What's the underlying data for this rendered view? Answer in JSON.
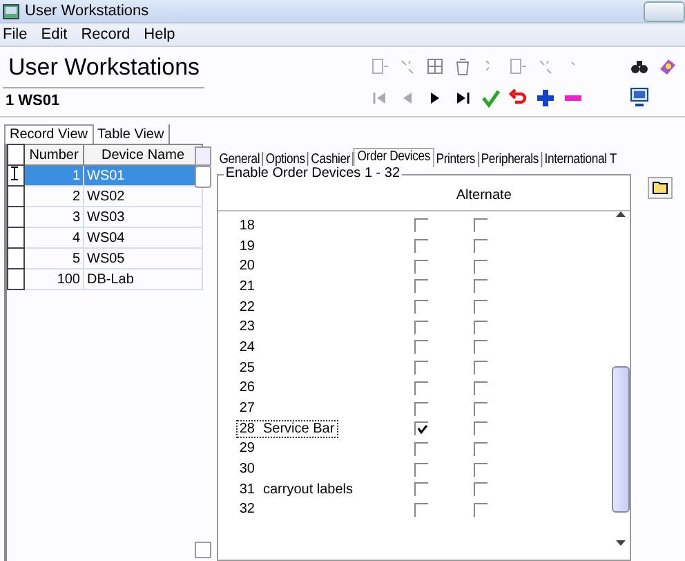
{
  "window": {
    "title": "User Workstations"
  },
  "menu": [
    "File",
    "Edit",
    "Record",
    "Help"
  ],
  "header": {
    "title": "User Workstations",
    "record": "1 WS01"
  },
  "view_tabs": [
    {
      "label": "Record View",
      "selected": true
    },
    {
      "label": "Table View",
      "selected": false
    }
  ],
  "grid": {
    "columns": [
      "Number",
      "Device Name"
    ],
    "rows": [
      {
        "number": "1",
        "name": "WS01",
        "selected": true
      },
      {
        "number": "2",
        "name": "WS02",
        "selected": false
      },
      {
        "number": "3",
        "name": "WS03",
        "selected": false
      },
      {
        "number": "4",
        "name": "WS04",
        "selected": false
      },
      {
        "number": "5",
        "name": "WS05",
        "selected": false
      },
      {
        "number": "100",
        "name": "DB-Lab",
        "selected": false
      }
    ]
  },
  "detail_tabs": [
    {
      "label": "General",
      "selected": false
    },
    {
      "label": "Options",
      "selected": false
    },
    {
      "label": "Cashier",
      "selected": false
    },
    {
      "label": "Order Devices",
      "selected": true
    },
    {
      "label": "Printers",
      "selected": false
    },
    {
      "label": "Peripherals",
      "selected": false
    },
    {
      "label": "International T",
      "selected": false
    }
  ],
  "group": {
    "title": "Enable Order Devices 1 - 32",
    "column_header": "Alternate",
    "devices": [
      {
        "number": "18",
        "enabled": false,
        "alternate": false,
        "focused": false
      },
      {
        "number": "19",
        "enabled": false,
        "alternate": false,
        "focused": false
      },
      {
        "number": "20",
        "enabled": false,
        "alternate": false,
        "focused": false
      },
      {
        "number": "21",
        "enabled": false,
        "alternate": false,
        "focused": false
      },
      {
        "number": "22",
        "enabled": false,
        "alternate": false,
        "focused": false
      },
      {
        "number": "23",
        "enabled": false,
        "alternate": false,
        "focused": false
      },
      {
        "number": "24",
        "enabled": false,
        "alternate": false,
        "focused": false
      },
      {
        "number": "25",
        "enabled": false,
        "alternate": false,
        "focused": false
      },
      {
        "number": "26",
        "enabled": false,
        "alternate": false,
        "focused": false
      },
      {
        "number": "27",
        "enabled": false,
        "alternate": false,
        "focused": false
      },
      {
        "number": "28",
        "name": "Service Bar",
        "enabled": true,
        "alternate": false,
        "focused": true
      },
      {
        "number": "29",
        "enabled": false,
        "alternate": false,
        "focused": false
      },
      {
        "number": "30",
        "enabled": false,
        "alternate": false,
        "focused": false
      },
      {
        "number": "31",
        "name": "carryout labels",
        "enabled": false,
        "alternate": false,
        "focused": false
      },
      {
        "number": "32",
        "enabled": false,
        "alternate": false,
        "focused": false
      }
    ]
  }
}
